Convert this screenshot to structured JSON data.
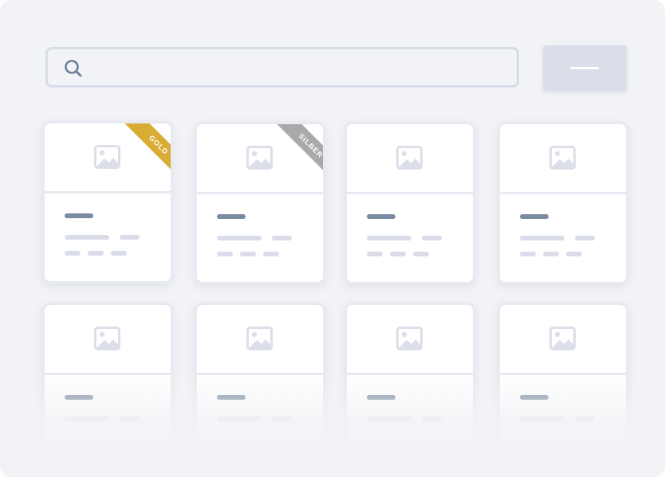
{
  "search": {
    "value": "",
    "icon": "search-icon"
  },
  "action_button": {
    "icon": "minus-icon"
  },
  "colors": {
    "background": "#f2f3f6",
    "button": "#d9dee9",
    "title_bar": "#7a8aa0",
    "text_placeholder": "#dadde9",
    "gold_ribbon": "#d9ac35",
    "silver_ribbon": "#a9a9a9"
  },
  "cards": [
    {
      "badge": "GOLD",
      "badge_color": "#d9ac35",
      "image_icon": "image-icon"
    },
    {
      "badge": "SILBER",
      "badge_color": "#a9a9a9",
      "image_icon": "image-icon"
    },
    {
      "badge": "",
      "image_icon": "image-icon"
    },
    {
      "badge": "",
      "image_icon": "image-icon"
    },
    {
      "badge": "",
      "image_icon": "image-icon"
    },
    {
      "badge": "",
      "image_icon": "image-icon"
    },
    {
      "badge": "",
      "image_icon": "image-icon"
    },
    {
      "badge": "",
      "image_icon": "image-icon"
    }
  ]
}
